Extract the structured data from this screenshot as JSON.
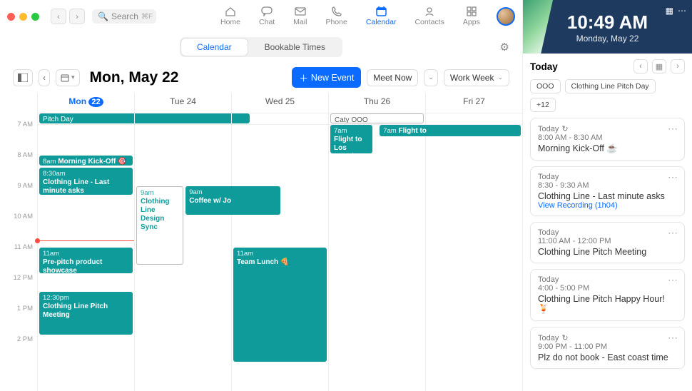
{
  "topbar": {
    "search_placeholder": "Search",
    "search_shortcut": "⌘F",
    "nav": [
      {
        "label": "Home"
      },
      {
        "label": "Chat"
      },
      {
        "label": "Mail"
      },
      {
        "label": "Phone"
      },
      {
        "label": "Calendar"
      },
      {
        "label": "Contacts"
      },
      {
        "label": "Apps"
      }
    ]
  },
  "subtabs": {
    "calendar": "Calendar",
    "bookable": "Bookable Times"
  },
  "header": {
    "title": "Mon, May 22",
    "new_event": "New Event",
    "meet_now": "Meet Now",
    "view": "Work Week"
  },
  "days": [
    {
      "label": "Mon",
      "num": "22",
      "today": true
    },
    {
      "label": "Tue",
      "num": "24"
    },
    {
      "label": "Wed",
      "num": "25"
    },
    {
      "label": "Thu",
      "num": "26"
    },
    {
      "label": "Fri",
      "num": "27"
    }
  ],
  "hours": [
    "7 AM",
    "8 AM",
    "9 AM",
    "10 AM",
    "11 AM",
    "12 PM",
    "1 PM",
    "2 PM"
  ],
  "events": {
    "mon_allday": "Pitch Day",
    "thu_allday": "Caty OOO",
    "mon_8": {
      "time": "8am",
      "title": "Morning Kick-Off 🎯"
    },
    "mon_830": {
      "time": "8:30am",
      "title": "Clothing Line - Last minute asks"
    },
    "mon_11": {
      "time": "11am",
      "title": "Pre-pitch product showcase"
    },
    "mon_1230": {
      "time": "12:30pm",
      "title": "Clothing Line Pitch Meeting"
    },
    "tue_9": {
      "time": "9am",
      "title": "Clothing Line Design Sync"
    },
    "wed_9": {
      "time": "9am",
      "title": "Coffee w/ Jo"
    },
    "wed_11": {
      "time": "11am",
      "title": "Team Lunch 🍕"
    },
    "thu_7": {
      "time": "7am",
      "title": "Flight to Los Angeles"
    },
    "fri_7": {
      "time": "7am",
      "title": "Flight to"
    }
  },
  "right": {
    "time": "10:49 AM",
    "date": "Monday, May 22",
    "today_heading": "Today",
    "chips": [
      "OOO",
      "Clothing Line Pitch Day",
      "+12"
    ],
    "cards": [
      {
        "day": "Today",
        "range": "8:00 AM - 8:30 AM",
        "title": "Morning Kick-Off ☕",
        "recur": true
      },
      {
        "day": "Today",
        "range": "8:30 - 9:30 AM",
        "title": "Clothing Line - Last minute asks",
        "link": "View Recording (1h04)"
      },
      {
        "day": "Today",
        "range": "11:00 AM - 12:00 PM",
        "title": "Clothing Line Pitch Meeting"
      },
      {
        "day": "Today",
        "range": "4:00 - 5:00 PM",
        "title": "Clothing Line Pitch Happy Hour! 🍹"
      },
      {
        "day": "Today",
        "range": "9:00 PM - 11:00 PM",
        "title": "Plz do not book - East coast time",
        "recur": true
      }
    ]
  }
}
